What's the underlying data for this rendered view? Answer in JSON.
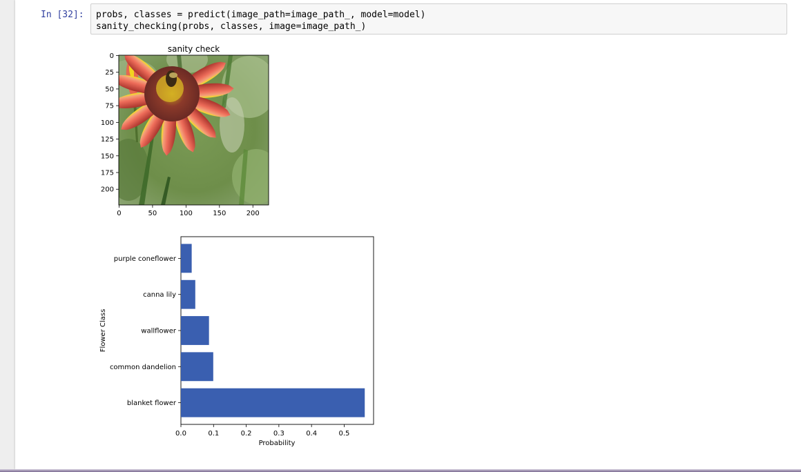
{
  "cell": {
    "prompt": "In [32]:",
    "code_lines": [
      "probs, classes = predict(image_path=image_path_, model=model)",
      "sanity_checking(probs, classes, image=image_path_)"
    ]
  },
  "image_plot": {
    "title": "sanity check",
    "x_ticks": [
      "0",
      "50",
      "100",
      "150",
      "200"
    ],
    "y_ticks": [
      "0",
      "25",
      "50",
      "75",
      "100",
      "125",
      "150",
      "175",
      "200"
    ],
    "image_extent": [
      0,
      224
    ]
  },
  "chart_data": {
    "type": "bar",
    "orientation": "horizontal",
    "categories": [
      "blanket flower",
      "common dandelion",
      "wallflower",
      "canna lily",
      "purple coneflower"
    ],
    "values": [
      0.563,
      0.099,
      0.086,
      0.044,
      0.033
    ],
    "xlabel": "Probability",
    "ylabel": "Flower Class",
    "xlim": [
      0,
      0.59
    ],
    "x_ticks": [
      "0.0",
      "0.1",
      "0.2",
      "0.3",
      "0.4",
      "0.5"
    ],
    "bar_color": "#3a5fb0",
    "grid": false
  },
  "colors": {
    "prompt": "#303f9f",
    "input_bg": "#f7f7f7",
    "input_border": "#cfcfcf"
  }
}
